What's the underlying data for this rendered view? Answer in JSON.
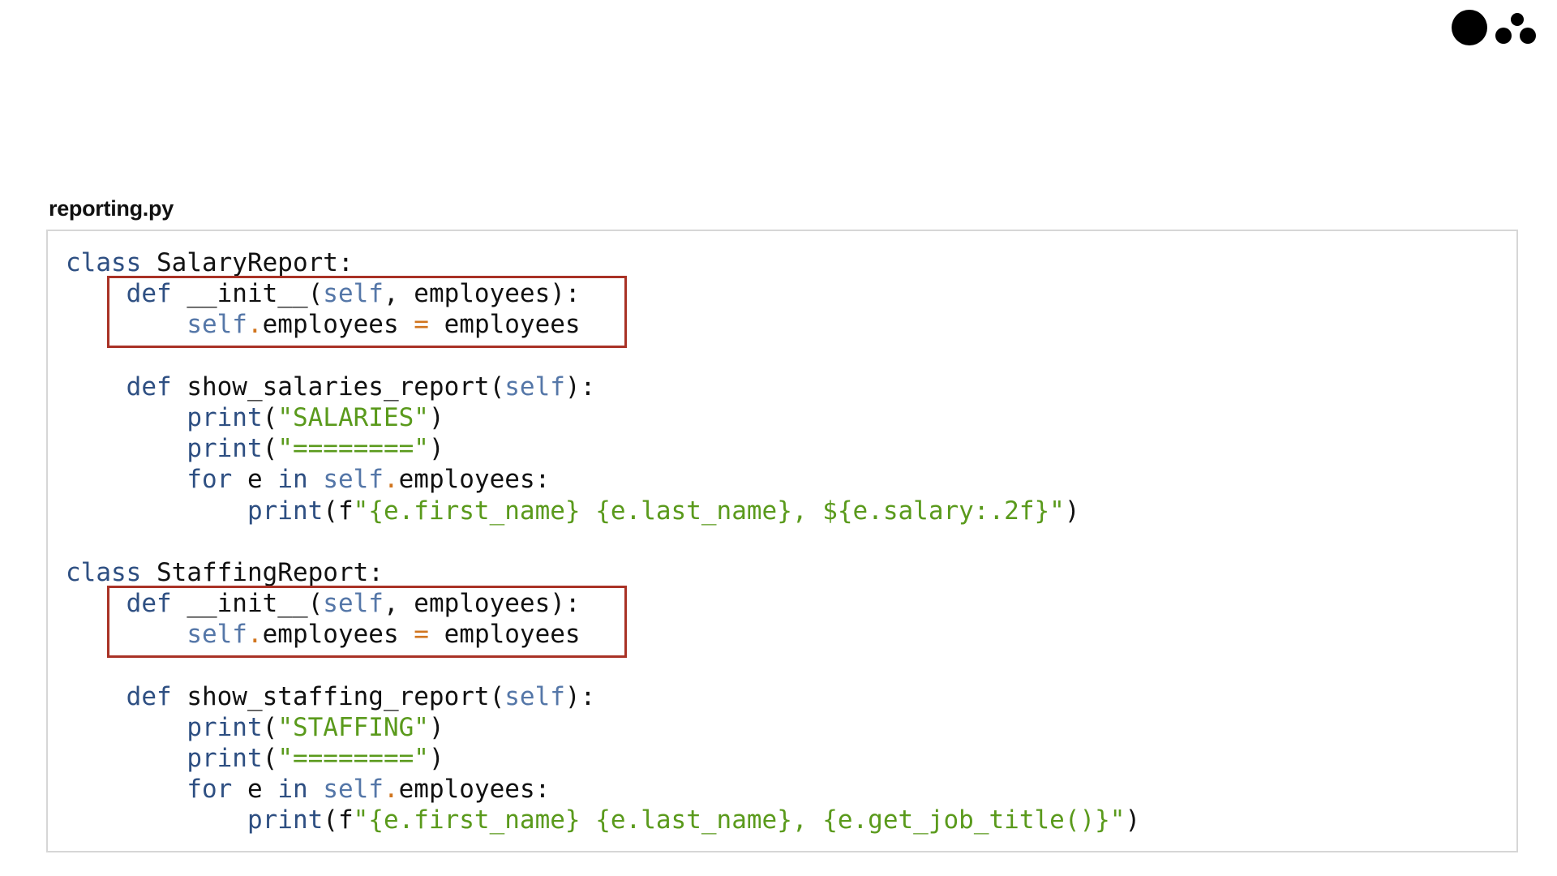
{
  "file_title": "reporting.py",
  "logo": {
    "icon": "three-dots-logo"
  },
  "colors": {
    "keyword": "#2e4f82",
    "self": "#5577a8",
    "string": "#5a9a1c",
    "operator": "#d1751f",
    "highlight_border": "#a93226"
  },
  "highlights": [
    {
      "class": "SalaryReport",
      "method": "__init__"
    },
    {
      "class": "StaffingReport",
      "method": "__init__"
    }
  ],
  "code_lines": [
    [
      {
        "t": "class",
        "c": "kw"
      },
      {
        "t": " SalaryReport:",
        "c": ""
      }
    ],
    [
      {
        "t": "    ",
        "c": ""
      },
      {
        "t": "def",
        "c": "kw"
      },
      {
        "t": " __init__(",
        "c": ""
      },
      {
        "t": "self",
        "c": "slf"
      },
      {
        "t": ", employees):",
        "c": ""
      }
    ],
    [
      {
        "t": "        ",
        "c": ""
      },
      {
        "t": "self",
        "c": "slf"
      },
      {
        "t": ".",
        "c": "op"
      },
      {
        "t": "employees ",
        "c": ""
      },
      {
        "t": "=",
        "c": "op"
      },
      {
        "t": " employees",
        "c": ""
      }
    ],
    [],
    [
      {
        "t": "    ",
        "c": ""
      },
      {
        "t": "def",
        "c": "kw"
      },
      {
        "t": " show_salaries_report(",
        "c": ""
      },
      {
        "t": "self",
        "c": "slf"
      },
      {
        "t": "):",
        "c": ""
      }
    ],
    [
      {
        "t": "        ",
        "c": ""
      },
      {
        "t": "print",
        "c": "kw"
      },
      {
        "t": "(",
        "c": ""
      },
      {
        "t": "\"SALARIES\"",
        "c": "str"
      },
      {
        "t": ")",
        "c": ""
      }
    ],
    [
      {
        "t": "        ",
        "c": ""
      },
      {
        "t": "print",
        "c": "kw"
      },
      {
        "t": "(",
        "c": ""
      },
      {
        "t": "\"========\"",
        "c": "str"
      },
      {
        "t": ")",
        "c": ""
      }
    ],
    [
      {
        "t": "        ",
        "c": ""
      },
      {
        "t": "for",
        "c": "kw"
      },
      {
        "t": " e ",
        "c": ""
      },
      {
        "t": "in",
        "c": "kw"
      },
      {
        "t": " ",
        "c": ""
      },
      {
        "t": "self",
        "c": "slf"
      },
      {
        "t": ".",
        "c": "op"
      },
      {
        "t": "employees:",
        "c": ""
      }
    ],
    [
      {
        "t": "            ",
        "c": ""
      },
      {
        "t": "print",
        "c": "kw"
      },
      {
        "t": "(f",
        "c": ""
      },
      {
        "t": "\"{e.first_name} {e.last_name}, ${e.salary:.2f}\"",
        "c": "str"
      },
      {
        "t": ")",
        "c": ""
      }
    ],
    [],
    [
      {
        "t": "class",
        "c": "kw"
      },
      {
        "t": " StaffingReport:",
        "c": ""
      }
    ],
    [
      {
        "t": "    ",
        "c": ""
      },
      {
        "t": "def",
        "c": "kw"
      },
      {
        "t": " __init__(",
        "c": ""
      },
      {
        "t": "self",
        "c": "slf"
      },
      {
        "t": ", employees):",
        "c": ""
      }
    ],
    [
      {
        "t": "        ",
        "c": ""
      },
      {
        "t": "self",
        "c": "slf"
      },
      {
        "t": ".",
        "c": "op"
      },
      {
        "t": "employees ",
        "c": ""
      },
      {
        "t": "=",
        "c": "op"
      },
      {
        "t": " employees",
        "c": ""
      }
    ],
    [],
    [
      {
        "t": "    ",
        "c": ""
      },
      {
        "t": "def",
        "c": "kw"
      },
      {
        "t": " show_staffing_report(",
        "c": ""
      },
      {
        "t": "self",
        "c": "slf"
      },
      {
        "t": "):",
        "c": ""
      }
    ],
    [
      {
        "t": "        ",
        "c": ""
      },
      {
        "t": "print",
        "c": "kw"
      },
      {
        "t": "(",
        "c": ""
      },
      {
        "t": "\"STAFFING\"",
        "c": "str"
      },
      {
        "t": ")",
        "c": ""
      }
    ],
    [
      {
        "t": "        ",
        "c": ""
      },
      {
        "t": "print",
        "c": "kw"
      },
      {
        "t": "(",
        "c": ""
      },
      {
        "t": "\"========\"",
        "c": "str"
      },
      {
        "t": ")",
        "c": ""
      }
    ],
    [
      {
        "t": "        ",
        "c": ""
      },
      {
        "t": "for",
        "c": "kw"
      },
      {
        "t": " e ",
        "c": ""
      },
      {
        "t": "in",
        "c": "kw"
      },
      {
        "t": " ",
        "c": ""
      },
      {
        "t": "self",
        "c": "slf"
      },
      {
        "t": ".",
        "c": "op"
      },
      {
        "t": "employees:",
        "c": ""
      }
    ],
    [
      {
        "t": "            ",
        "c": ""
      },
      {
        "t": "print",
        "c": "kw"
      },
      {
        "t": "(f",
        "c": ""
      },
      {
        "t": "\"{e.first_name} {e.last_name}, {e.get_job_title()}\"",
        "c": "str"
      },
      {
        "t": ")",
        "c": ""
      }
    ]
  ]
}
